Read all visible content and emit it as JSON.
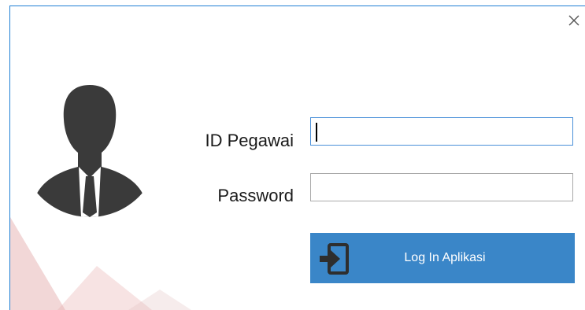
{
  "window": {
    "close_icon": "close-icon",
    "accent_color": "#1f7fd4"
  },
  "avatar": {
    "icon": "user-silhouette-icon"
  },
  "form": {
    "id_label": "ID Pegawai",
    "id_value": "",
    "password_label": "Password",
    "password_value": ""
  },
  "login_button": {
    "label": "Log In Aplikasi",
    "icon": "sign-in-icon",
    "color": "#3a86c8"
  }
}
